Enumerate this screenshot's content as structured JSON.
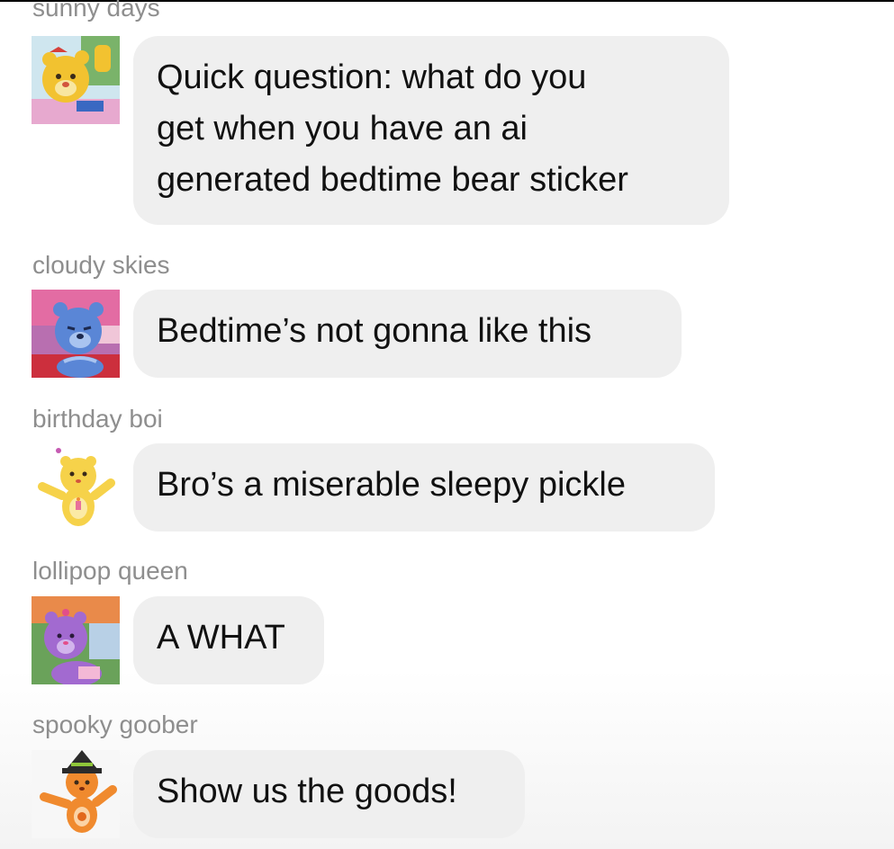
{
  "messages": [
    {
      "sender": "sunny days",
      "avatar_icon": "yellow-bear-avatar-icon",
      "lines": [
        "Quick question: what do you",
        "get when you have an ai",
        "generated bedtime bear sticker"
      ]
    },
    {
      "sender": "cloudy skies",
      "avatar_icon": "blue-bear-avatar-icon",
      "lines": [
        "Bedtime’s not gonna like this"
      ]
    },
    {
      "sender": "birthday boi",
      "avatar_icon": "yellow-birthday-bear-avatar-icon",
      "lines": [
        "Bro’s a miserable sleepy pickle"
      ]
    },
    {
      "sender": "lollipop queen",
      "avatar_icon": "purple-bear-avatar-icon",
      "lines": [
        "A WHAT"
      ]
    },
    {
      "sender": "spooky goober",
      "avatar_icon": "orange-witch-bear-avatar-icon",
      "lines": [
        "Show us the goods!"
      ]
    }
  ],
  "colors": {
    "bubble": "#efefef",
    "sender": "#8e8e8e",
    "text": "#111111"
  }
}
